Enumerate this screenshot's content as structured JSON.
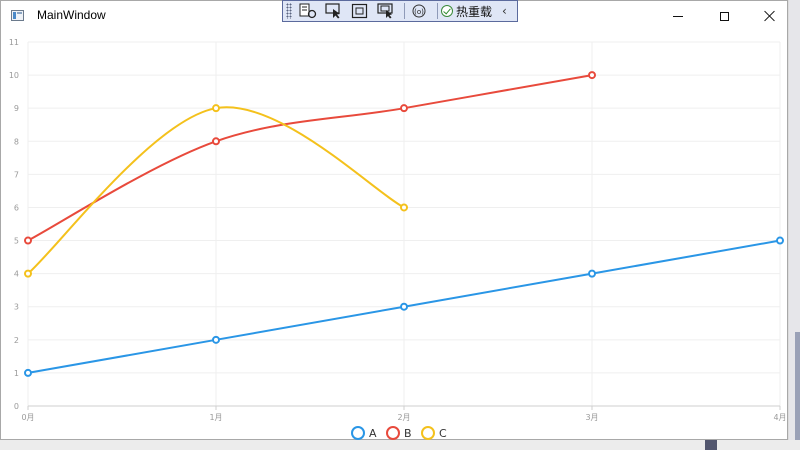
{
  "window": {
    "title": "MainWindow",
    "controls": {
      "minimize": "minimize",
      "maximize": "maximize",
      "close": "close"
    }
  },
  "toolbar": {
    "hot_reload_label": "热重载",
    "icons": [
      "live-visual-tree-icon",
      "select-element-icon",
      "display-layout-adorners-icon",
      "track-focus-icon",
      "binding-failures-icon",
      "hot-reload-status-icon",
      "collapse-icon"
    ]
  },
  "chart_data": {
    "type": "line",
    "categories": [
      "0月",
      "1月",
      "2月",
      "3月",
      "4月"
    ],
    "ylim": [
      0,
      11
    ],
    "yticks": [
      "0",
      "1",
      "2",
      "3",
      "4",
      "5",
      "6",
      "7",
      "8",
      "9",
      "10",
      "11"
    ],
    "grid": true,
    "legend_position": "bottom",
    "series": [
      {
        "name": "A",
        "color": "#2a96e6",
        "smooth": false,
        "values": [
          1,
          2,
          3,
          4,
          5
        ]
      },
      {
        "name": "B",
        "color": "#e84a3c",
        "smooth": true,
        "values": [
          5,
          8,
          9,
          10
        ]
      },
      {
        "name": "C",
        "color": "#f4c11c",
        "smooth": true,
        "values": [
          4,
          9,
          6
        ]
      }
    ]
  }
}
